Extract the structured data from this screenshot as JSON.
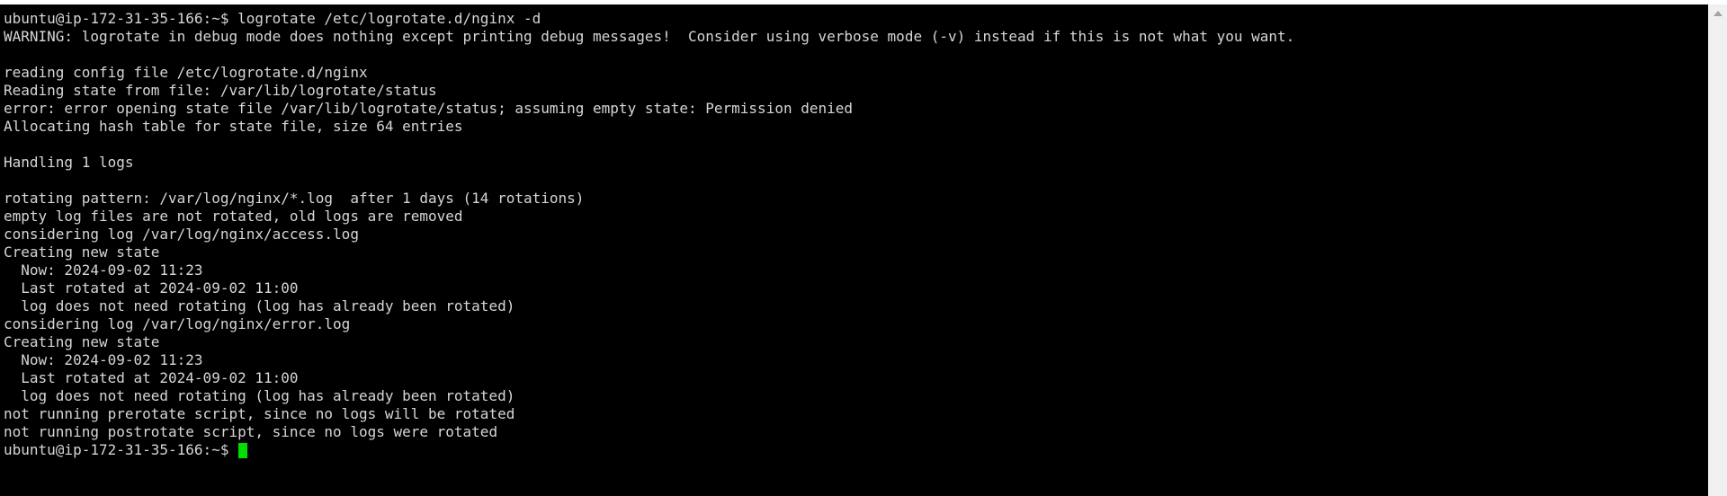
{
  "terminal": {
    "lines": [
      "ubuntu@ip-172-31-35-166:~$ logrotate /etc/logrotate.d/nginx -d",
      "WARNING: logrotate in debug mode does nothing except printing debug messages!  Consider using verbose mode (-v) instead if this is not what you want.",
      "",
      "reading config file /etc/logrotate.d/nginx",
      "Reading state from file: /var/lib/logrotate/status",
      "error: error opening state file /var/lib/logrotate/status; assuming empty state: Permission denied",
      "Allocating hash table for state file, size 64 entries",
      "",
      "Handling 1 logs",
      "",
      "rotating pattern: /var/log/nginx/*.log  after 1 days (14 rotations)",
      "empty log files are not rotated, old logs are removed",
      "considering log /var/log/nginx/access.log",
      "Creating new state",
      "  Now: 2024-09-02 11:23",
      "  Last rotated at 2024-09-02 11:00",
      "  log does not need rotating (log has already been rotated)",
      "considering log /var/log/nginx/error.log",
      "Creating new state",
      "  Now: 2024-09-02 11:23",
      "  Last rotated at 2024-09-02 11:00",
      "  log does not need rotating (log has already been rotated)",
      "not running prerotate script, since no logs will be rotated",
      "not running postrotate script, since no logs were rotated"
    ],
    "prompt": "ubuntu@ip-172-31-35-166:~$ ",
    "colors": {
      "background": "#000000",
      "text": "#d6d6d6",
      "cursor": "#00e000",
      "scrollbar": "#f0f0f0"
    }
  },
  "scrollbar": {
    "up_arrow_icon": "triangle-up-icon"
  }
}
